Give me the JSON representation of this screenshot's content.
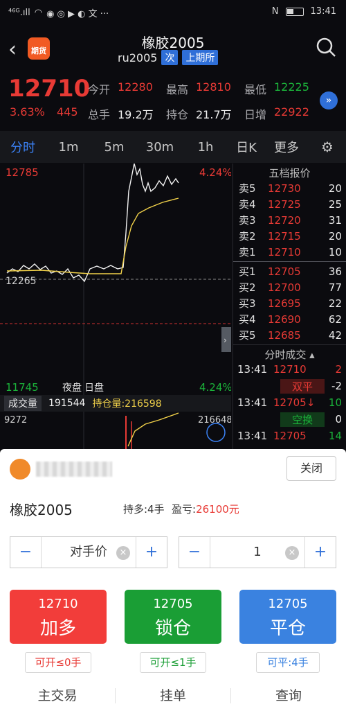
{
  "status_bar": {
    "left": "⁴⁶ᴳ.ıll",
    "time": "13:41",
    "nfc": "N"
  },
  "header": {
    "title": "橡胶2005",
    "code": "ru2005",
    "tag1": "次",
    "tag2": "上期所",
    "logo_text": "期货"
  },
  "quote": {
    "last": "12710",
    "pct": "3.63%",
    "chg": "445",
    "open_label": "今开",
    "open": "12280",
    "high_label": "最高",
    "high": "12810",
    "low_label": "最低",
    "low": "12225",
    "vol_label": "总手",
    "vol": "19.2万",
    "oi_label": "持仓",
    "oi": "21.7万",
    "day_inc_label": "日增",
    "day_inc": "22922"
  },
  "tabs": [
    "分时",
    "1m",
    "5m",
    "30m",
    "1h",
    "日K",
    "更多"
  ],
  "chart": {
    "top_price": "12785",
    "top_pct": "4.24%",
    "bottom_price": "11745",
    "bottom_pct": "4.24%",
    "mid_price": "12265",
    "night": "夜盘",
    "day": "日盘",
    "vol_label": "成交量",
    "vol_value": "191544",
    "oi_text": "持仓量:216598",
    "vol_max": "9272",
    "oi_max": "216648"
  },
  "orderbook": {
    "title": "五档报价",
    "asks": [
      {
        "n": "卖5",
        "p": "12730",
        "q": "20"
      },
      {
        "n": "卖4",
        "p": "12725",
        "q": "25"
      },
      {
        "n": "卖3",
        "p": "12720",
        "q": "31"
      },
      {
        "n": "卖2",
        "p": "12715",
        "q": "20"
      },
      {
        "n": "卖1",
        "p": "12710",
        "q": "10"
      }
    ],
    "bids": [
      {
        "n": "买1",
        "p": "12705",
        "q": "36"
      },
      {
        "n": "买2",
        "p": "12700",
        "q": "77"
      },
      {
        "n": "买3",
        "p": "12695",
        "q": "22"
      },
      {
        "n": "买4",
        "p": "12690",
        "q": "62"
      },
      {
        "n": "买5",
        "p": "12685",
        "q": "42"
      }
    ],
    "ts_title": "分时成交",
    "ticks": [
      {
        "t": "13:41",
        "p": "12710",
        "v": "2",
        "tag": "双平",
        "tv": "-2"
      },
      {
        "t": "13:41",
        "p": "12705↓",
        "v": "10",
        "tag": "空换",
        "tv": "0"
      },
      {
        "t": "13:41",
        "p": "12705",
        "v": "14",
        "tag": "",
        "tv": ""
      }
    ]
  },
  "panel": {
    "close": "关闭",
    "name": "橡胶2005",
    "hold": "持多:4手",
    "pnl_label": "盈亏:",
    "pnl": "26100元",
    "price_mode": "对手价",
    "qty": "1",
    "buy": {
      "price": "12710",
      "label": "加多"
    },
    "lock": {
      "price": "12705",
      "label": "锁仓"
    },
    "close_pos": {
      "price": "12705",
      "label": "平仓"
    },
    "pill1": "可开≤0手",
    "pill2": "可开≤1手",
    "pill3": "可平:4手",
    "nav": [
      "主交易",
      "挂单",
      "查询"
    ]
  }
}
